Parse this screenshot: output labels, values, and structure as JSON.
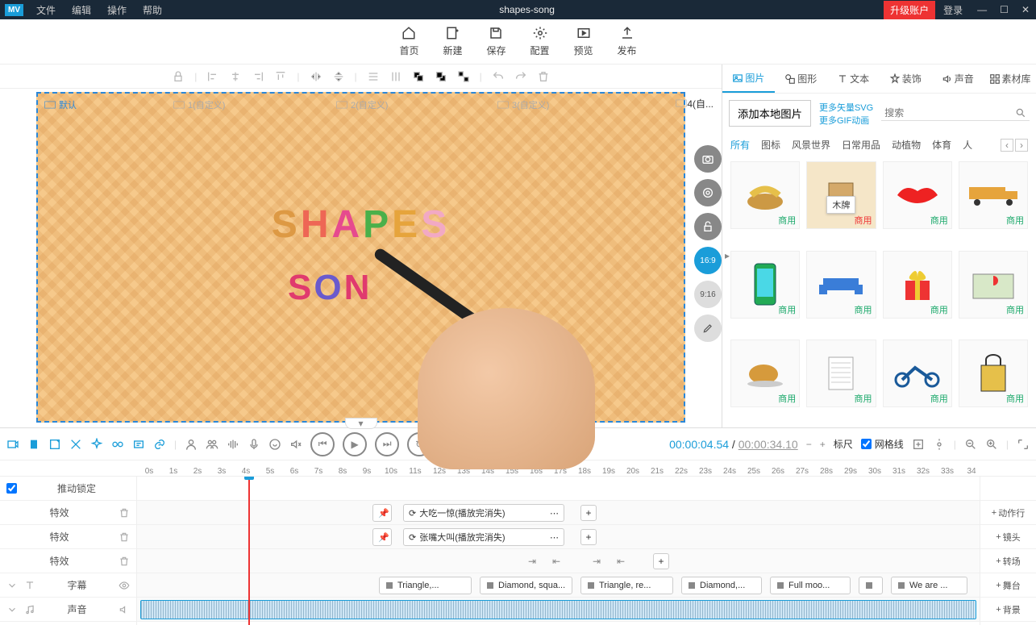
{
  "titlebar": {
    "logo": "MV",
    "menu": [
      "文件",
      "编辑",
      "操作",
      "帮助"
    ],
    "title": "shapes-song",
    "upgrade": "升级账户",
    "login": "登录"
  },
  "toptoolbar": [
    {
      "id": "home",
      "label": "首页"
    },
    {
      "id": "new",
      "label": "新建"
    },
    {
      "id": "save",
      "label": "保存"
    },
    {
      "id": "config",
      "label": "配置"
    },
    {
      "id": "preview",
      "label": "预览"
    },
    {
      "id": "publish",
      "label": "发布"
    }
  ],
  "canvas": {
    "slides": [
      "默认",
      "1(自定义)",
      "2(自定义)",
      "3(自定义)",
      "4(自..."
    ],
    "title_chars": [
      "S",
      "H",
      "A",
      "P",
      "E",
      "S"
    ],
    "sub_chars": [
      "S",
      "O",
      "N"
    ],
    "ratios": {
      "a": "16:9",
      "b": "9:16"
    }
  },
  "rightpanel": {
    "tabs": [
      "图片",
      "图形",
      "文本",
      "装饰",
      "声音",
      "素材库"
    ],
    "add_local": "添加本地图片",
    "link1": "更多矢量SVG",
    "link2": "更多GIF动画",
    "search_ph": "搜索",
    "cats": [
      "所有",
      "图标",
      "风景世界",
      "日常用品",
      "动植物",
      "体育",
      "人"
    ],
    "tooltip": "木牌",
    "tag": "商用"
  },
  "playbar": {
    "cur": "00:00:04.54",
    "sep": " / ",
    "tot": "00:00:34.10",
    "scale_lbl": "标尺",
    "grid_lbl": "网格线"
  },
  "tracks": {
    "lock_lbl": "推动锁定",
    "rows": [
      "特效",
      "特效",
      "特效",
      "字幕",
      "声音"
    ],
    "clip1": "大吃一惊(播放完消失)",
    "clip2": "张嘴大叫(播放完消失)",
    "textclips": [
      "Triangle,...",
      "Diamond, squa...",
      "Triangle, re...",
      "Diamond,...",
      "Full moo...",
      "",
      "We are ..."
    ],
    "sidebtns": [
      "动作行",
      "镜头",
      "转场",
      "舞台",
      "背景"
    ]
  },
  "ruler_ticks": [
    "0s",
    "1s",
    "2s",
    "3s",
    "4s",
    "5s",
    "6s",
    "7s",
    "8s",
    "9s",
    "10s",
    "11s",
    "12s",
    "13s",
    "14s",
    "15s",
    "16s",
    "17s",
    "18s",
    "19s",
    "20s",
    "21s",
    "22s",
    "23s",
    "24s",
    "25s",
    "26s",
    "27s",
    "28s",
    "29s",
    "30s",
    "31s",
    "32s",
    "33s",
    "34"
  ]
}
